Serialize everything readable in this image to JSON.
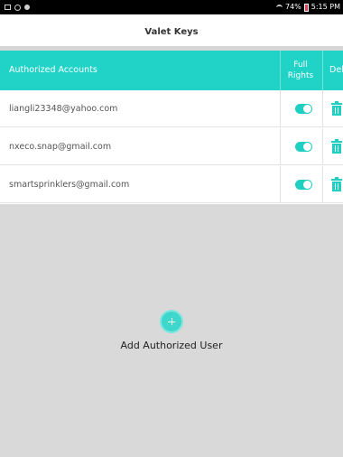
{
  "status_bar": {
    "battery_percent": "74%",
    "time": "5:15 PM",
    "icons": [
      "image-icon",
      "alarm-icon",
      "dot-icon",
      "wifi-icon",
      "battery-icon"
    ]
  },
  "header": {
    "title": "Valet Keys"
  },
  "table": {
    "columns": {
      "accounts": "Authorized Accounts",
      "rights_line1": "Full",
      "rights_line2": "Rights",
      "delete": "Delete"
    },
    "rows": [
      {
        "email": "liangli23348@yahoo.com",
        "full_rights": true
      },
      {
        "email": "nxeco.snap@gmail.com",
        "full_rights": true
      },
      {
        "email": "smartsprinklers@gmail.com",
        "full_rights": true
      }
    ]
  },
  "add_user": {
    "label": "Add Authorized User",
    "icon": "plus-circle-icon"
  },
  "colors": {
    "accent": "#21d3c7",
    "toggle_on": "#1fcfc1",
    "background_gray": "#d9d9d9"
  }
}
